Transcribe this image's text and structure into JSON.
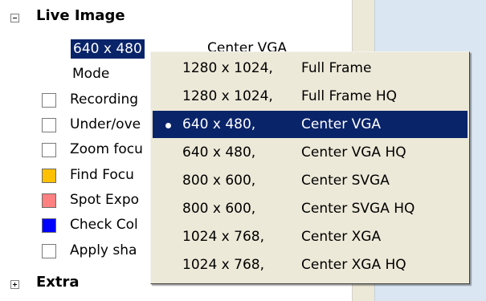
{
  "tree": {
    "live_image": {
      "label": "Live Image",
      "expander": "collapse"
    },
    "resolution": {
      "value": "640 x 480",
      "display": "Center VGA"
    },
    "mode": {
      "label": "Mode"
    },
    "items": [
      {
        "label": "Recording",
        "checked": false,
        "swatch": null
      },
      {
        "label": "Under/ove",
        "checked": false,
        "swatch": null
      },
      {
        "label": "Zoom focu",
        "checked": false,
        "swatch": null
      },
      {
        "label": "Find Focu",
        "swatch": "#ffc000"
      },
      {
        "label": "Spot Expo",
        "swatch": "#ff8080"
      },
      {
        "label": "Check Col",
        "swatch": "#0000ff"
      },
      {
        "label": "Apply sha",
        "checked": false,
        "swatch": null
      }
    ],
    "extra": {
      "label": "Extra",
      "expander": "expand"
    }
  },
  "menu": {
    "items": [
      {
        "res": "1280 x 1024,",
        "name": "Full Frame",
        "selected": false
      },
      {
        "res": "1280 x 1024,",
        "name": "Full Frame HQ",
        "selected": false
      },
      {
        "res": "640 x 480,",
        "name": "Center VGA",
        "selected": true
      },
      {
        "res": "640 x 480,",
        "name": "Center VGA HQ",
        "selected": false
      },
      {
        "res": "800 x 600,",
        "name": "Center SVGA",
        "selected": false
      },
      {
        "res": "800 x 600,",
        "name": "Center SVGA HQ",
        "selected": false
      },
      {
        "res": "1024 x 768,",
        "name": "Center XGA",
        "selected": false
      },
      {
        "res": "1024 x 768,",
        "name": "Center XGA HQ",
        "selected": false
      }
    ]
  },
  "colors": {
    "selection": "#0a246a",
    "menu_bg": "#ece9d8",
    "right_pane": "#dbe6f3"
  }
}
